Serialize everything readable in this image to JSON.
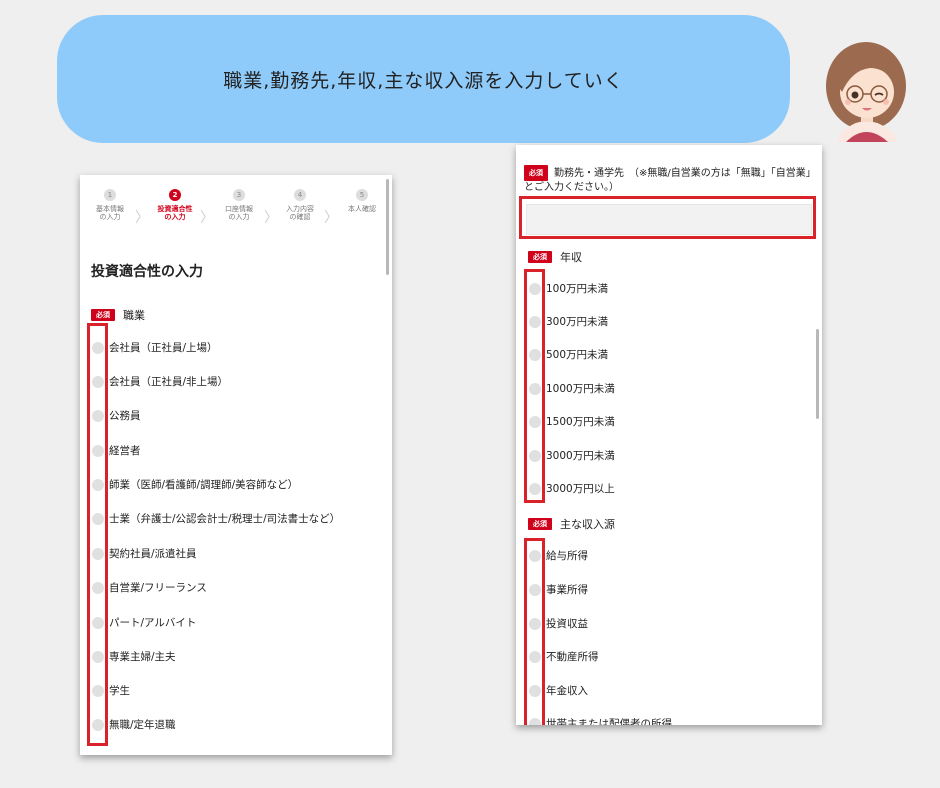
{
  "banner": {
    "text": "職業,勤務先,年収,主な収入源を入力していく"
  },
  "left_panel": {
    "steps": [
      {
        "number": "1",
        "label": "基本情報\nの入力"
      },
      {
        "number": "2",
        "label": "投資適合性\nの入力"
      },
      {
        "number": "3",
        "label": "口座情報\nの入力"
      },
      {
        "number": "4",
        "label": "入力内容\nの確認"
      },
      {
        "number": "5",
        "label": "本人確認"
      }
    ],
    "active_step": 2,
    "section_title": "投資適合性の入力",
    "required_badge": "必須",
    "occupation_label": "職業",
    "occupations": [
      "会社員（正社員/上場）",
      "会社員（正社員/非上場）",
      "公務員",
      "経営者",
      "師業（医師/看護師/調理師/美容師など）",
      "士業（弁護士/公認会計士/税理士/司法書士など）",
      "契約社員/派遣社員",
      "自営業/フリーランス",
      "パート/アルバイト",
      "専業主婦/主夫",
      "学生",
      "無職/定年退職"
    ]
  },
  "right_panel": {
    "required_badge": "必須",
    "workplace_label": "勤務先・通学先　（※無職/自営業の方は「無職」「自営業」とご入力ください。）",
    "workplace_value": "",
    "income_label": "年収",
    "incomes": [
      "100万円未満",
      "300万円未満",
      "500万円未満",
      "1000万円未満",
      "1500万円未満",
      "3000万円未満",
      "3000万円以上"
    ],
    "source_label": "主な収入源",
    "sources": [
      "給与所得",
      "事業所得",
      "投資収益",
      "不動産所得",
      "年金収入",
      "世帯主または配偶者の所得"
    ]
  },
  "colors": {
    "banner": "#8fcbfa",
    "accent": "#d0021b",
    "highlight_box": "#d9222a",
    "background": "#efefef"
  }
}
